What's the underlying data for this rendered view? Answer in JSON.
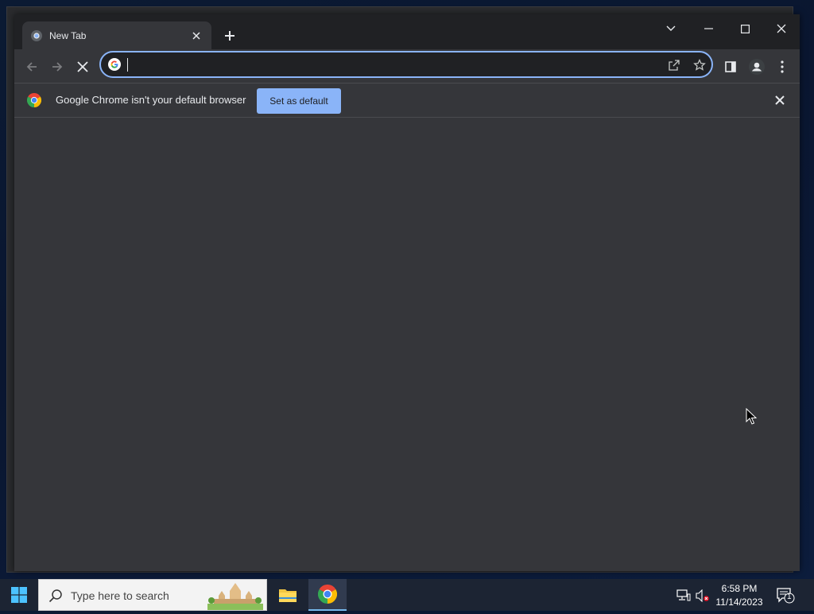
{
  "browser": {
    "tab": {
      "title": "New Tab"
    },
    "omnibox": {
      "value": "",
      "placeholder": ""
    },
    "infobar": {
      "message": "Google Chrome isn't your default browser",
      "button_label": "Set as default"
    },
    "icons": [
      "chrome-favicon",
      "close-icon",
      "plus-icon",
      "chevron-down-icon",
      "minimize-icon",
      "maximize-icon",
      "back-icon",
      "forward-icon",
      "stop-icon",
      "google-g-icon",
      "share-icon",
      "star-icon",
      "side-panel-icon",
      "profile-icon",
      "kebab-menu-icon"
    ],
    "accent": "#8ab4f8"
  },
  "taskbar": {
    "search_placeholder": "Type here to search",
    "time": "6:58 PM",
    "date": "11/14/2023",
    "notification_count": "1"
  }
}
